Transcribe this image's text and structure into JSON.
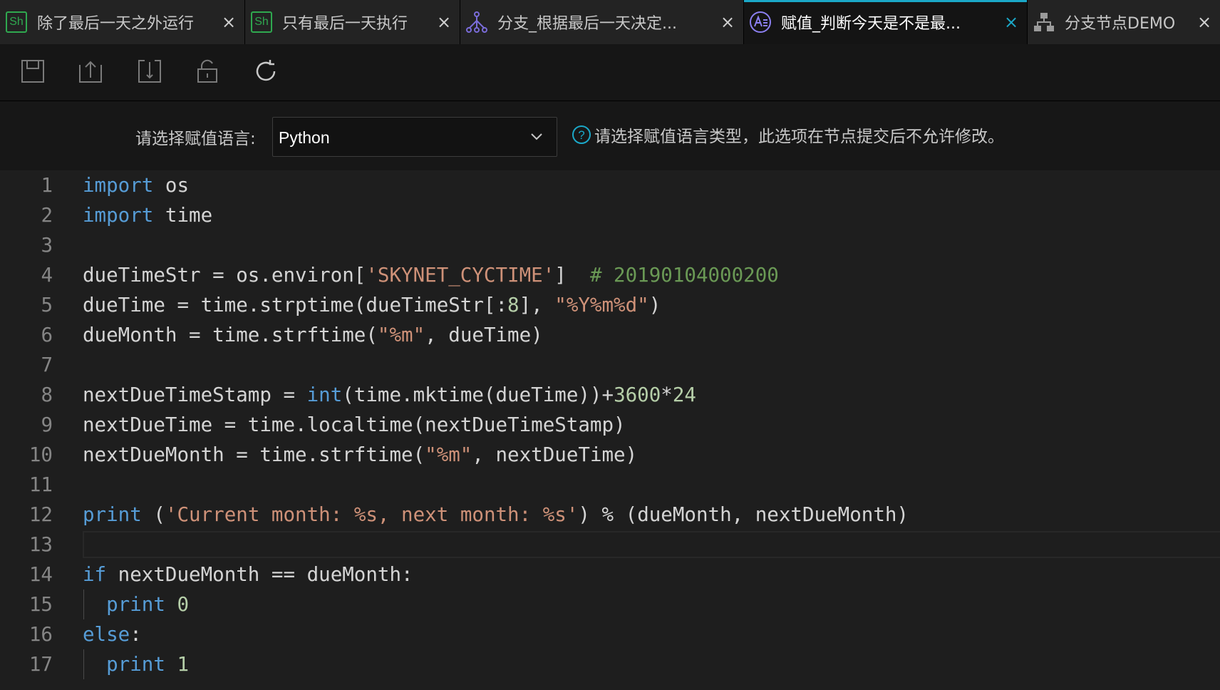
{
  "tabs": [
    {
      "label": "除了最后一天之外运行",
      "icon": "shell-badge-icon",
      "badge": "Sh",
      "active": false
    },
    {
      "label": "只有最后一天执行",
      "icon": "shell-badge-icon",
      "badge": "Sh",
      "active": false
    },
    {
      "label": "分支_根据最后一天决定...",
      "icon": "branch-icon",
      "active": false
    },
    {
      "label": "赋值_判断今天是不是最...",
      "icon": "assignment-icon",
      "active": true
    },
    {
      "label": "分支节点DEMO",
      "icon": "hierarchy-icon",
      "active": false
    }
  ],
  "toolbar": {
    "buttons": [
      "save-icon",
      "submit-icon",
      "publish-icon",
      "unlock-icon",
      "refresh-icon"
    ]
  },
  "language": {
    "label": "请选择赋值语言:",
    "value": "Python",
    "hint": "请选择赋值语言类型，此选项在节点提交后不允许修改。"
  },
  "colors": {
    "accent": "#1ba8c8",
    "shell_badge": "#2fa84f",
    "keyword": "#569cd6",
    "string": "#ce9178",
    "number": "#b5cea8",
    "comment": "#6a9955",
    "text": "#d4d4d4",
    "line_number": "#858585"
  },
  "code": {
    "current_line": 13,
    "lines": [
      {
        "n": "1",
        "tokens": [
          {
            "t": "import",
            "c": "kw"
          },
          {
            "t": " os",
            "c": "tx"
          }
        ]
      },
      {
        "n": "2",
        "tokens": [
          {
            "t": "import",
            "c": "kw"
          },
          {
            "t": " time",
            "c": "tx"
          }
        ]
      },
      {
        "n": "3",
        "tokens": []
      },
      {
        "n": "4",
        "tokens": [
          {
            "t": "dueTimeStr = os.environ[",
            "c": "tx"
          },
          {
            "t": "'SKYNET_CYCTIME'",
            "c": "str"
          },
          {
            "t": "]  ",
            "c": "tx"
          },
          {
            "t": "# 20190104000200",
            "c": "cm"
          }
        ]
      },
      {
        "n": "5",
        "tokens": [
          {
            "t": "dueTime = time.strptime(dueTimeStr[:",
            "c": "tx"
          },
          {
            "t": "8",
            "c": "num"
          },
          {
            "t": "], ",
            "c": "tx"
          },
          {
            "t": "\"%Y%m%d\"",
            "c": "str"
          },
          {
            "t": ")",
            "c": "tx"
          }
        ]
      },
      {
        "n": "6",
        "tokens": [
          {
            "t": "dueMonth = time.strftime(",
            "c": "tx"
          },
          {
            "t": "\"%m\"",
            "c": "str"
          },
          {
            "t": ", dueTime)",
            "c": "tx"
          }
        ]
      },
      {
        "n": "7",
        "tokens": []
      },
      {
        "n": "8",
        "tokens": [
          {
            "t": "nextDueTimeStamp = ",
            "c": "tx"
          },
          {
            "t": "int",
            "c": "kw"
          },
          {
            "t": "(time.mktime(dueTime))+",
            "c": "tx"
          },
          {
            "t": "3600",
            "c": "num"
          },
          {
            "t": "*",
            "c": "tx"
          },
          {
            "t": "24",
            "c": "num"
          }
        ]
      },
      {
        "n": "9",
        "tokens": [
          {
            "t": "nextDueTime = time.localtime(nextDueTimeStamp)",
            "c": "tx"
          }
        ]
      },
      {
        "n": "10",
        "tokens": [
          {
            "t": "nextDueMonth = time.strftime(",
            "c": "tx"
          },
          {
            "t": "\"%m\"",
            "c": "str"
          },
          {
            "t": ", nextDueTime)",
            "c": "tx"
          }
        ]
      },
      {
        "n": "11",
        "tokens": []
      },
      {
        "n": "12",
        "tokens": [
          {
            "t": "print",
            "c": "kw"
          },
          {
            "t": " (",
            "c": "tx"
          },
          {
            "t": "'Current month: %s, next month: %s'",
            "c": "str"
          },
          {
            "t": ") % (dueMonth, nextDueMonth)",
            "c": "tx"
          }
        ]
      },
      {
        "n": "13",
        "tokens": []
      },
      {
        "n": "14",
        "tokens": [
          {
            "t": "if",
            "c": "kw"
          },
          {
            "t": " nextDueMonth == dueMonth:",
            "c": "tx"
          }
        ]
      },
      {
        "n": "15",
        "indent": true,
        "tokens": [
          {
            "t": "  ",
            "c": "tx"
          },
          {
            "t": "print",
            "c": "kw"
          },
          {
            "t": " ",
            "c": "tx"
          },
          {
            "t": "0",
            "c": "num"
          }
        ]
      },
      {
        "n": "16",
        "tokens": [
          {
            "t": "else",
            "c": "kw"
          },
          {
            "t": ":",
            "c": "tx"
          }
        ]
      },
      {
        "n": "17",
        "indent": true,
        "tokens": [
          {
            "t": "  ",
            "c": "tx"
          },
          {
            "t": "print",
            "c": "kw"
          },
          {
            "t": " ",
            "c": "tx"
          },
          {
            "t": "1",
            "c": "num"
          }
        ]
      }
    ]
  }
}
